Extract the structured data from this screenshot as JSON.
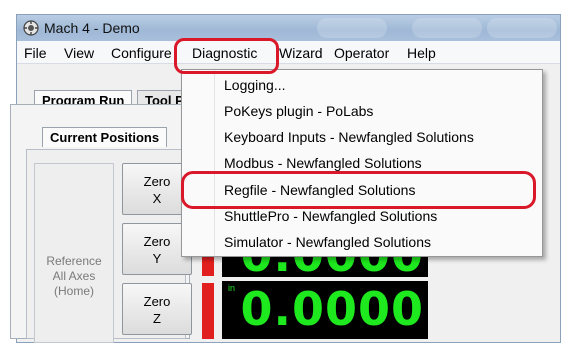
{
  "window": {
    "title": "Mach 4 - Demo",
    "icon": "mach-app-icon"
  },
  "menubar": {
    "items": [
      "File",
      "View",
      "Configure",
      "Diagnostic",
      "Wizard",
      "Operator",
      "Help"
    ],
    "open_menu": "Diagnostic"
  },
  "tabs": {
    "main": [
      "Program Run",
      "Tool Pa"
    ],
    "sub": [
      "Current Positions"
    ]
  },
  "reference": {
    "line1": "Reference",
    "line2": "All Axes",
    "line3": "(Home)"
  },
  "zero_buttons": [
    {
      "label": "Zero",
      "axis": "X"
    },
    {
      "label": "Zero",
      "axis": "Y"
    },
    {
      "label": "Zero",
      "axis": "Z"
    }
  ],
  "dro": [
    {
      "unit": "",
      "value": "0.0000"
    },
    {
      "unit": "in",
      "value": "0.0000"
    }
  ],
  "diagnostic_menu": [
    "Logging...",
    "PoKeys plugin - PoLabs",
    "Keyboard Inputs - Newfangled Solutions",
    "Modbus - Newfangled Solutions",
    "Regfile - Newfangled Solutions",
    "ShuttlePro - Newfangled Solutions",
    "Simulator - Newfangled Solutions"
  ],
  "highlighted_item": "Regfile - Newfangled Solutions",
  "colors": {
    "highlight": "#d9192a",
    "dro_text": "#1ee81e",
    "dro_bg": "#000000",
    "limit_bar": "#e21f1f"
  }
}
